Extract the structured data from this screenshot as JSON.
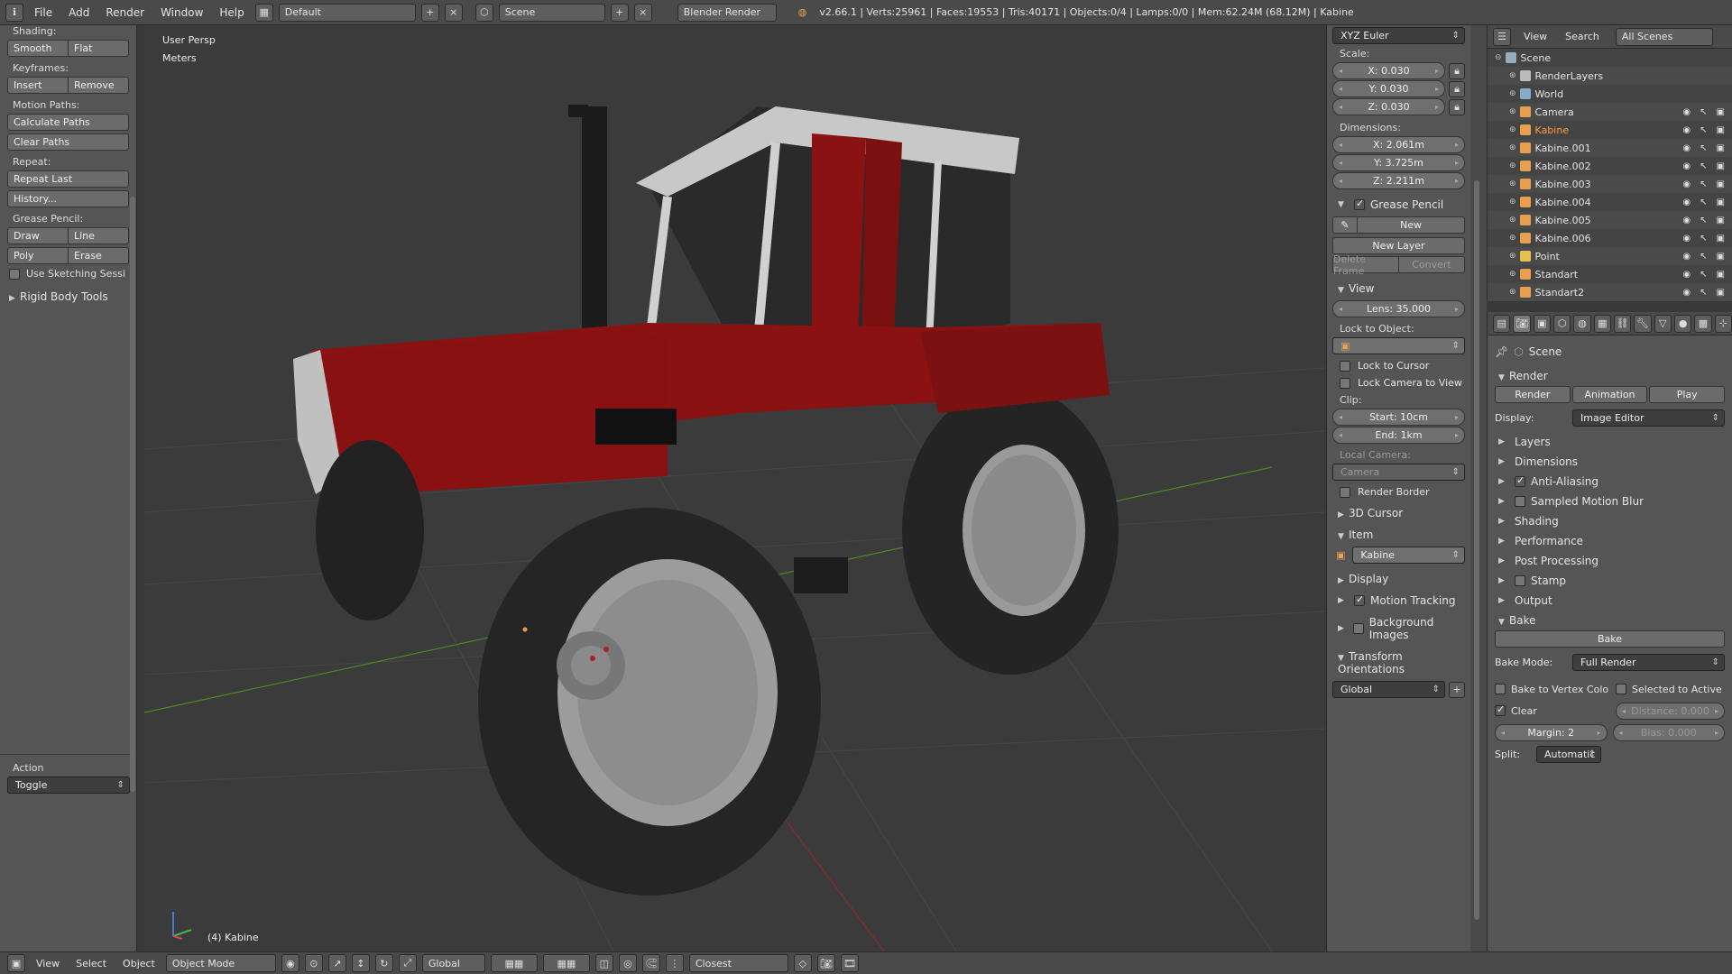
{
  "topbar": {
    "menus": [
      "File",
      "Add",
      "Render",
      "Window",
      "Help"
    ],
    "layout": "Default",
    "scene": "Scene",
    "engine": "Blender Render",
    "stats": "v2.66.1 | Verts:25961 | Faces:19553 | Tris:40171 | Objects:0/4 | Lamps:0/0 | Mem:62.24M (68.12M) | Kabine"
  },
  "toolshelf": {
    "shading_label": "Shading:",
    "smooth": "Smooth",
    "flat": "Flat",
    "keyframes_label": "Keyframes:",
    "insert": "Insert",
    "remove": "Remove",
    "motion_label": "Motion Paths:",
    "calc_paths": "Calculate Paths",
    "clear_paths": "Clear Paths",
    "repeat_label": "Repeat:",
    "repeat_last": "Repeat Last",
    "history": "History...",
    "gp_label": "Grease Pencil:",
    "draw": "Draw",
    "line": "Line",
    "poly": "Poly",
    "erase": "Erase",
    "sketch": "Use Sketching Sessi",
    "rigid": "Rigid Body Tools",
    "action_label": "Action",
    "action_value": "Toggle"
  },
  "viewport": {
    "persp": "User Persp",
    "units": "Meters",
    "object": "(4) Kabine"
  },
  "npanel": {
    "rotation_mode": "XYZ Euler",
    "scale_label": "Scale:",
    "scale_x": "X: 0.030",
    "scale_y": "Y: 0.030",
    "scale_z": "Z: 0.030",
    "dim_label": "Dimensions:",
    "dim_x": "X: 2.061m",
    "dim_y": "Y: 3.725m",
    "dim_z": "Z: 2.211m",
    "grease": "Grease Pencil",
    "new": "New",
    "new_layer": "New Layer",
    "delete_frame": "Delete Frame",
    "convert": "Convert",
    "view": "View",
    "lens": "Lens: 35.000",
    "lock_obj": "Lock to Object:",
    "lock_cursor": "Lock to Cursor",
    "lock_cam": "Lock Camera to View",
    "clip": "Clip:",
    "clip_start": "Start: 10cm",
    "clip_end": "End: 1km",
    "local_cam": "Local Camera:",
    "camera": "Camera",
    "render_border": "Render Border",
    "cursor3d": "3D Cursor",
    "item": "Item",
    "item_name": "Kabine",
    "display": "Display",
    "motion_tracking": "Motion Tracking",
    "bg_images": "Background Images",
    "transform_orient": "Transform Orientations",
    "orient_value": "Global"
  },
  "outliner": {
    "view": "View",
    "search": "Search",
    "filter": "All Scenes",
    "rows": [
      {
        "name": "Scene",
        "indent": 0,
        "icon": "#9ab"
      },
      {
        "name": "RenderLayers",
        "indent": 1,
        "icon": "#bbb"
      },
      {
        "name": "World",
        "indent": 1,
        "icon": "#8ac"
      },
      {
        "name": "Camera",
        "indent": 1,
        "icon": "#e8a050"
      },
      {
        "name": "Kabine",
        "indent": 1,
        "icon": "#e8a050",
        "selected": true
      },
      {
        "name": "Kabine.001",
        "indent": 1,
        "icon": "#e8a050"
      },
      {
        "name": "Kabine.002",
        "indent": 1,
        "icon": "#e8a050"
      },
      {
        "name": "Kabine.003",
        "indent": 1,
        "icon": "#e8a050"
      },
      {
        "name": "Kabine.004",
        "indent": 1,
        "icon": "#e8a050"
      },
      {
        "name": "Kabine.005",
        "indent": 1,
        "icon": "#e8a050"
      },
      {
        "name": "Kabine.006",
        "indent": 1,
        "icon": "#e8a050"
      },
      {
        "name": "Point",
        "indent": 1,
        "icon": "#e8c050"
      },
      {
        "name": "Standart",
        "indent": 1,
        "icon": "#e8a050"
      },
      {
        "name": "Standart2",
        "indent": 1,
        "icon": "#e8a050"
      }
    ]
  },
  "props": {
    "scene": "Scene",
    "render": "Render",
    "render_btn": "Render",
    "anim_btn": "Animation",
    "play_btn": "Play",
    "display_label": "Display:",
    "display_value": "Image Editor",
    "sections": [
      "Layers",
      "Dimensions",
      "Anti-Aliasing",
      "Sampled Motion Blur",
      "Shading",
      "Performance",
      "Post Processing",
      "Stamp",
      "Output"
    ],
    "bake": "Bake",
    "bake_btn": "Bake",
    "bake_mode_label": "Bake Mode:",
    "bake_mode": "Full Render",
    "bake_vertex": "Bake to Vertex Colo",
    "selected_active": "Selected to Active",
    "clear": "Clear",
    "distance": "Distance: 0.000",
    "margin": "Margin: 2",
    "bias": "Bias: 0.000",
    "split_label": "Split:",
    "split_value": "Automatic"
  },
  "bottombar": {
    "view": "View",
    "select": "Select",
    "object": "Object",
    "mode": "Object Mode",
    "orientation": "Global",
    "snap": "Closest"
  },
  "colors": {
    "tractor_red": "#8b1212",
    "tire": "#262626",
    "rim": "#9c9c9c",
    "grid_green": "#4a8a2a",
    "grid_red": "#8a2a2a"
  }
}
